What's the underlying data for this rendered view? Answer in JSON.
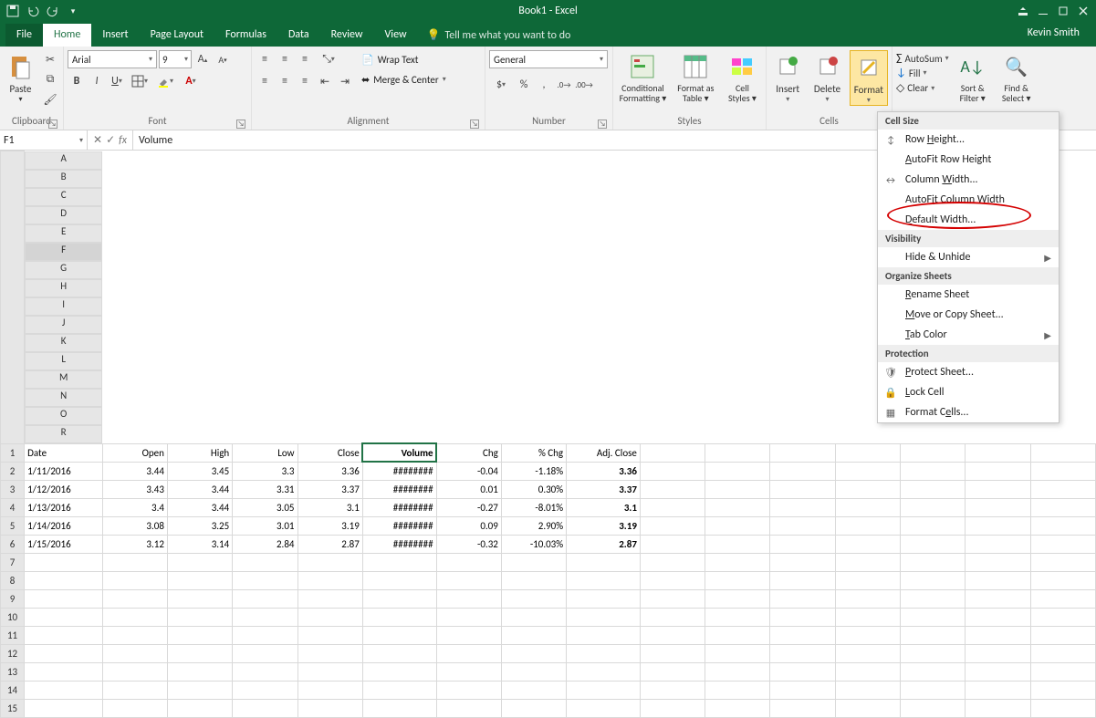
{
  "titlebar": {
    "title": "Book1 - Excel"
  },
  "user": "Kevin Smith",
  "tabs": {
    "file": "File",
    "home": "Home",
    "insert": "Insert",
    "pagelayout": "Page Layout",
    "formulas": "Formulas",
    "data": "Data",
    "review": "Review",
    "view": "View",
    "tellme": "Tell me what you want to do"
  },
  "ribbon": {
    "clipboard": {
      "paste": "Paste",
      "label": "Clipboard"
    },
    "font": {
      "name": "Arial",
      "size": "9",
      "label": "Font"
    },
    "alignment": {
      "wrap": "Wrap Text",
      "merge": "Merge & Center",
      "label": "Alignment"
    },
    "number": {
      "fmt": "General",
      "label": "Number"
    },
    "styles": {
      "cf": "Conditional Formatting",
      "fat": "Format as Table",
      "cs": "Cell Styles",
      "label": "Styles"
    },
    "cells": {
      "insert": "Insert",
      "delete": "Delete",
      "format": "Format",
      "label": "Cells"
    },
    "editing": {
      "autosum": "AutoSum",
      "fill": "Fill",
      "clear": "Clear",
      "sort": "Sort & Filter",
      "find": "Find & Select"
    }
  },
  "namebox": "F1",
  "formula": "Volume",
  "columns": [
    "",
    "A",
    "B",
    "C",
    "D",
    "E",
    "F",
    "G",
    "H",
    "I",
    "J",
    "K",
    "L",
    "M",
    "N",
    "O",
    "R"
  ],
  "headers": [
    "Date",
    "Open",
    "High",
    "Low",
    "Close",
    "Volume",
    "Chg",
    "% Chg",
    "Adj. Close"
  ],
  "rows": [
    {
      "date": "1/11/2016",
      "open": "3.44",
      "high": "3.45",
      "low": "3.3",
      "close": "3.36",
      "vol": "########",
      "chg": "-0.04",
      "pchg": "-1.18%",
      "adj": "3.36",
      "pcolor": "red"
    },
    {
      "date": "1/12/2016",
      "open": "3.43",
      "high": "3.44",
      "low": "3.31",
      "close": "3.37",
      "vol": "########",
      "chg": "0.01",
      "pchg": "0.30%",
      "adj": "3.37",
      "pcolor": "green"
    },
    {
      "date": "1/13/2016",
      "open": "3.4",
      "high": "3.44",
      "low": "3.05",
      "close": "3.1",
      "vol": "########",
      "chg": "-0.27",
      "pchg": "-8.01%",
      "adj": "3.1",
      "pcolor": "red"
    },
    {
      "date": "1/14/2016",
      "open": "3.08",
      "high": "3.25",
      "low": "3.01",
      "close": "3.19",
      "vol": "########",
      "chg": "0.09",
      "pchg": "2.90%",
      "adj": "3.19",
      "pcolor": "green"
    },
    {
      "date": "1/15/2016",
      "open": "3.12",
      "high": "3.14",
      "low": "2.84",
      "close": "2.87",
      "vol": "########",
      "chg": "-0.32",
      "pchg": "-10.03%",
      "adj": "2.87",
      "pcolor": "red"
    }
  ],
  "menu": {
    "s1": "Cell Size",
    "rowh": "Row Height...",
    "afrh": "AutoFit Row Height",
    "colw": "Column Width...",
    "afcw": "AutoFit Column Width",
    "defw": "Default Width...",
    "s2": "Visibility",
    "hide": "Hide & Unhide",
    "s3": "Organize Sheets",
    "rename": "Rename Sheet",
    "move": "Move or Copy Sheet...",
    "tabcolor": "Tab Color",
    "s4": "Protection",
    "protect": "Protect Sheet...",
    "lock": "Lock Cell",
    "fmtcells": "Format Cells..."
  }
}
